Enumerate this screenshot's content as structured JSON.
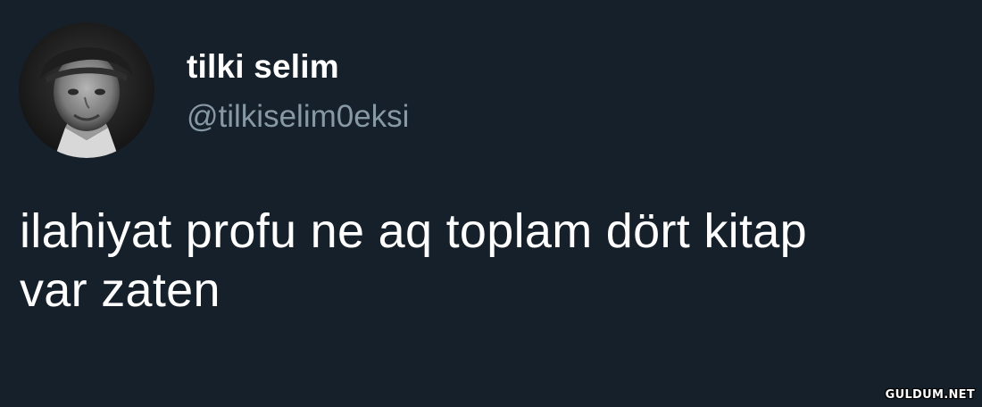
{
  "tweet": {
    "author": {
      "display_name": "tilki selim",
      "handle": "@tilkiselim0eksi",
      "avatar_icon": "profile-photo"
    },
    "text_lines": [
      "ilahiyat profu ne aq toplam dört kitap",
      "var zaten"
    ]
  },
  "watermark": "GULDUM.NET",
  "colors": {
    "background": "#15202b",
    "display_name": "#ffffff",
    "handle": "#8899a6",
    "text": "#ffffff"
  }
}
